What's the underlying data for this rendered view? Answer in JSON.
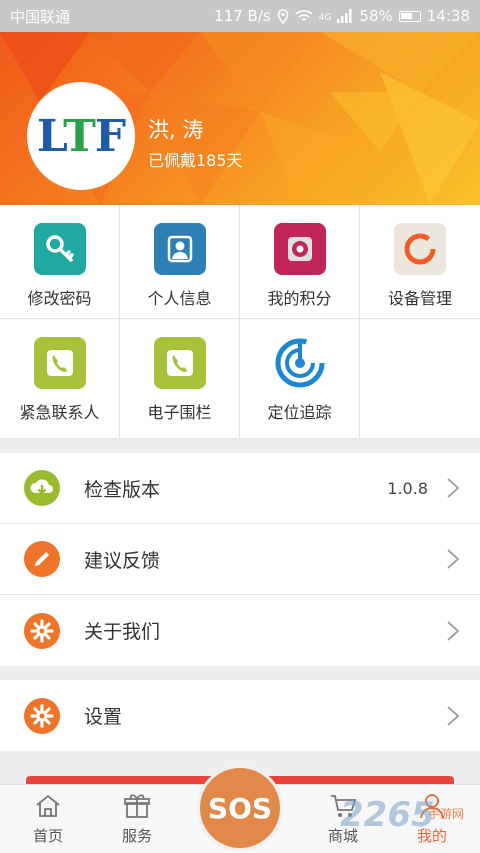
{
  "status_bar": {
    "carrier": "中国联通",
    "speed": "117 B/s",
    "network": "4G",
    "battery": "58%",
    "time": "14:38"
  },
  "profile": {
    "logo_text": "LTF",
    "name": "洪, 涛",
    "worn_days": "已佩戴185天"
  },
  "grid": [
    {
      "label": "修改密码",
      "icon": "key-icon",
      "color": "#1fa9a0"
    },
    {
      "label": "个人信息",
      "icon": "person-icon",
      "color": "#2e7fb3"
    },
    {
      "label": "我的积分",
      "icon": "points-icon",
      "color": "#c2245c"
    },
    {
      "label": "设备管理",
      "icon": "device-ring-icon",
      "color": "#f25c2a"
    },
    {
      "label": "紧急联系人",
      "icon": "phone-icon",
      "color": "#a6c13a"
    },
    {
      "label": "电子围栏",
      "icon": "phone-icon",
      "color": "#a6c13a"
    },
    {
      "label": "定位追踪",
      "icon": "radar-icon",
      "color": "#1e87d0"
    }
  ],
  "menu1": [
    {
      "label": "检查版本",
      "value": "1.0.8",
      "icon": "cloud-download-icon",
      "color": "#9bbb2e"
    },
    {
      "label": "建议反馈",
      "value": "",
      "icon": "pencil-icon",
      "color": "#f0732a"
    },
    {
      "label": "关于我们",
      "value": "",
      "icon": "gear-icon",
      "color": "#f0732a"
    }
  ],
  "menu2": [
    {
      "label": "设置",
      "value": "",
      "icon": "gear-icon",
      "color": "#f0732a"
    }
  ],
  "tabs": {
    "home": "首页",
    "service": "服务",
    "sos": "SOS",
    "mall": "商城",
    "mine": "我的"
  },
  "watermark": {
    "big": "2265",
    "small": "手游网"
  }
}
